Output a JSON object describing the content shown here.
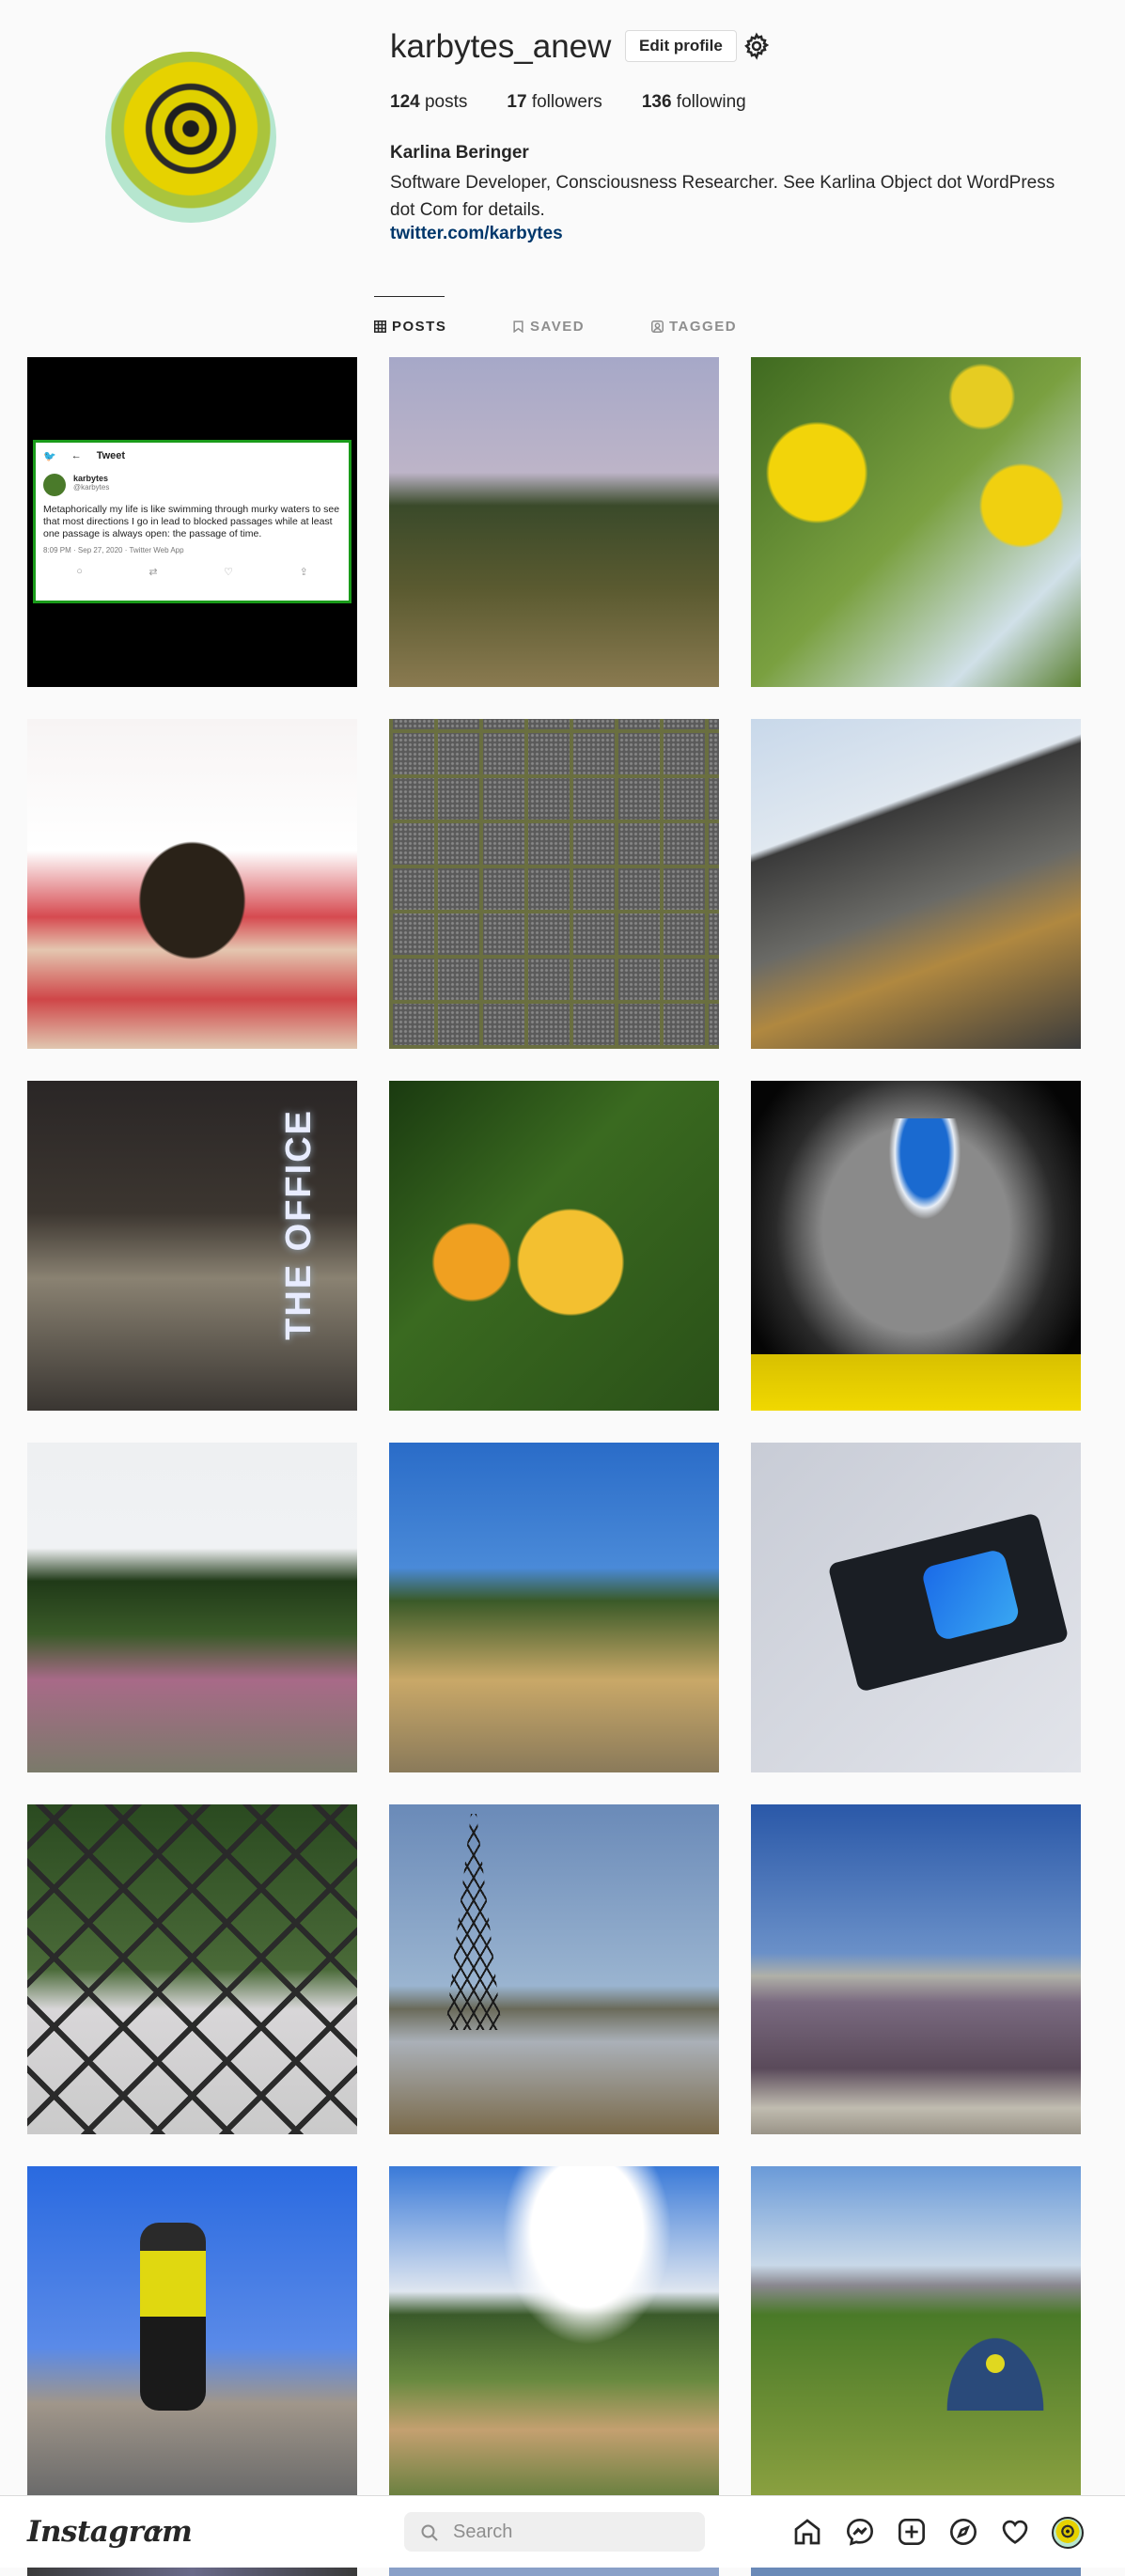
{
  "profile": {
    "username": "karbytes_anew",
    "edit_label": "Edit profile",
    "posts_count": "124",
    "posts_label": "posts",
    "followers_count": "17",
    "followers_label": "followers",
    "following_count": "136",
    "following_label": "following",
    "full_name": "Karlina Beringer",
    "bio": "Software Developer, Consciousness Researcher. See Karlina Object dot WordPress dot Com for details.",
    "link": "twitter.com/karbytes"
  },
  "tabs": [
    {
      "label": "POSTS",
      "icon": "grid-icon",
      "active": true
    },
    {
      "label": "SAVED",
      "icon": "bookmark-icon",
      "active": false
    },
    {
      "label": "TAGGED",
      "icon": "tag-icon",
      "active": false
    }
  ],
  "tweet": {
    "header": "Tweet",
    "name": "karbytes",
    "handle": "@karbytes",
    "text": "Metaphorically my life is like swimming through murky waters to see that most directions I go in lead to blocked passages while at least one passage is always open: the passage of time.",
    "meta": "8:09 PM · Sep 27, 2020 · Twitter Web App"
  },
  "office_sign": "THE OFFICE",
  "bottom_nav": {
    "logo": "Instagram",
    "search_placeholder": "Search",
    "icons": [
      "home-icon",
      "messenger-icon",
      "new-post-icon",
      "explore-icon",
      "heart-icon",
      "profile-avatar"
    ]
  },
  "colors": {
    "link": "#00376b",
    "text": "#262626",
    "muted": "#8e8e8e",
    "background": "#fafafa"
  }
}
